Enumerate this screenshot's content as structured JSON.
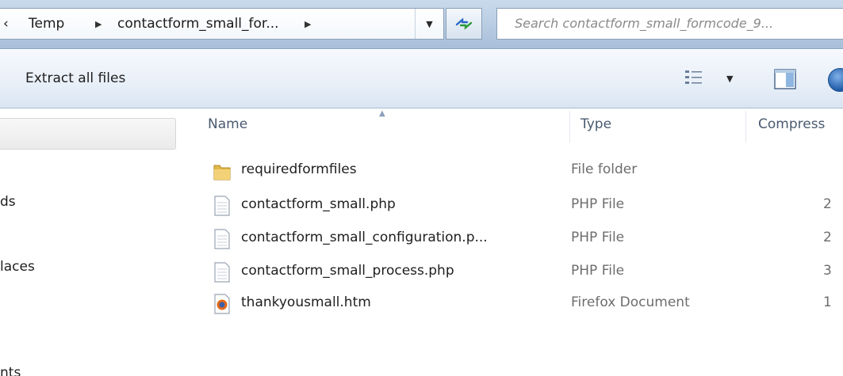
{
  "address_bar": {
    "overflow_glyph": "‹",
    "crumbs": [
      "Temp",
      "contactform_small_for..."
    ],
    "search_placeholder": "Search contactform_small_formcode_9..."
  },
  "toolbar": {
    "extract_label": "Extract all files",
    "icons": [
      "views-icon",
      "preview-pane-icon",
      "help-icon"
    ]
  },
  "nav_pane": {
    "items": [
      "ds",
      "laces",
      "nts"
    ]
  },
  "columns": {
    "name": "Name",
    "type": "Type",
    "size": "Compress"
  },
  "files": [
    {
      "name": "requiredformfiles",
      "type": "File folder",
      "size": "",
      "icon": "folder-icon"
    },
    {
      "name": "contactform_small.php",
      "type": "PHP File",
      "size": "2",
      "icon": "document-icon"
    },
    {
      "name": "contactform_small_configuration.p...",
      "type": "PHP File",
      "size": "2",
      "icon": "document-icon"
    },
    {
      "name": "contactform_small_process.php",
      "type": "PHP File",
      "size": "3",
      "icon": "document-icon"
    },
    {
      "name": "thankyousmall.htm",
      "type": "Firefox Document",
      "size": "1",
      "icon": "firefox-icon"
    }
  ],
  "colors": {
    "addr_bar": "#b9cde3",
    "toolbar": "#e9f0f8",
    "header_text": "#4a5a70",
    "secondary_text": "#6d6d6d"
  }
}
